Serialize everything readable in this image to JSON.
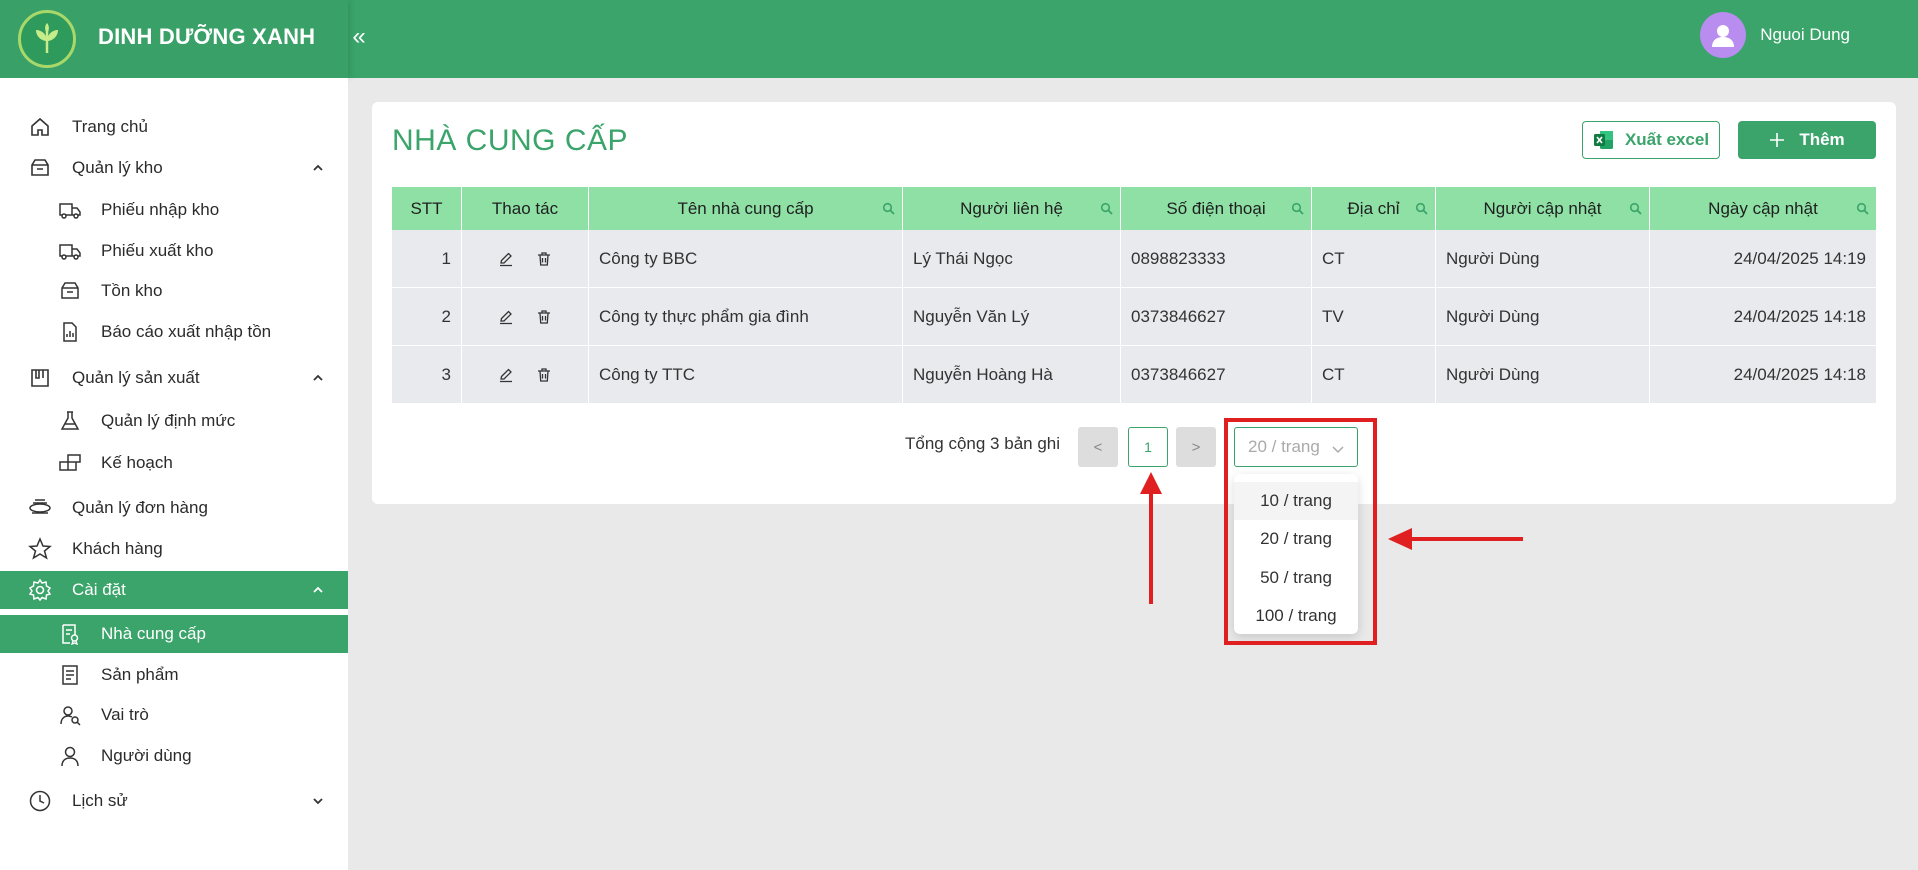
{
  "header": {
    "brand": "DINH DƯỠNG XANH",
    "collapse_icon": "«",
    "user_name": "Nguoi Dung"
  },
  "sidebar": {
    "items": [
      {
        "label": "Trang chủ",
        "icon": "home-icon"
      },
      {
        "label": "Quản lý kho",
        "icon": "box-icon",
        "expanded": true
      },
      {
        "label": "Phiếu nhập kho",
        "icon": "truck-in-icon"
      },
      {
        "label": "Phiếu xuất kho",
        "icon": "truck-out-icon"
      },
      {
        "label": "Tồn kho",
        "icon": "inventory-icon"
      },
      {
        "label": "Báo cáo xuất nhập tồn",
        "icon": "report-icon"
      },
      {
        "label": "Quản lý sản xuất",
        "icon": "factory-icon",
        "expanded": true
      },
      {
        "label": "Quản lý định mức",
        "icon": "flask-icon"
      },
      {
        "label": "Kế hoạch",
        "icon": "blocks-icon"
      },
      {
        "label": "Quản lý đơn hàng",
        "icon": "order-icon"
      },
      {
        "label": "Khách hàng",
        "icon": "star-icon"
      },
      {
        "label": "Cài đặt",
        "icon": "gear-icon",
        "expanded": true
      },
      {
        "label": "Nhà cung cấp",
        "icon": "supplier-icon",
        "active": true
      },
      {
        "label": "Sản phẩm",
        "icon": "product-icon"
      },
      {
        "label": "Vai trò",
        "icon": "roles-icon"
      },
      {
        "label": "Người dùng",
        "icon": "user-icon"
      },
      {
        "label": "Lịch sử",
        "icon": "history-icon",
        "expanded": false
      }
    ]
  },
  "main": {
    "title": "NHÀ CUNG CẤP",
    "export_label": "Xuất excel",
    "add_label": "Thêm",
    "columns": [
      "STT",
      "Thao tác",
      "Tên nhà cung cấp",
      "Người liên hệ",
      "Số điện thoại",
      "Địa chỉ",
      "Người cập nhật",
      "Ngày cập nhật"
    ],
    "rows": [
      {
        "stt": "1",
        "name": "Công ty BBC",
        "contact": "Lý Thái Ngọc",
        "phone": "0898823333",
        "address": "CT",
        "updated_by": "Người Dùng",
        "updated_at": "24/04/2025 14:19"
      },
      {
        "stt": "2",
        "name": "Công ty thực phẩm gia đình",
        "contact": "Nguyễn Văn Lý",
        "phone": "0373846627",
        "address": "TV",
        "updated_by": "Người Dùng",
        "updated_at": "24/04/2025 14:18"
      },
      {
        "stt": "3",
        "name": "Công ty TTC",
        "contact": "Nguyễn Hoàng Hà",
        "phone": "0373846627",
        "address": "CT",
        "updated_by": "Người Dùng",
        "updated_at": "24/04/2025 14:18"
      }
    ]
  },
  "pagination": {
    "total": "Tổng cộng 3 bản ghi",
    "prev": "<",
    "current_page": "1",
    "next": ">",
    "page_size": "20 / trang",
    "options": [
      "10 / trang",
      "20 / trang",
      "50 / trang",
      "100 / trang"
    ]
  },
  "colors": {
    "brand_green": "#3aa46a",
    "header_row": "#8ee0a5",
    "annotation_red": "#e02020"
  }
}
